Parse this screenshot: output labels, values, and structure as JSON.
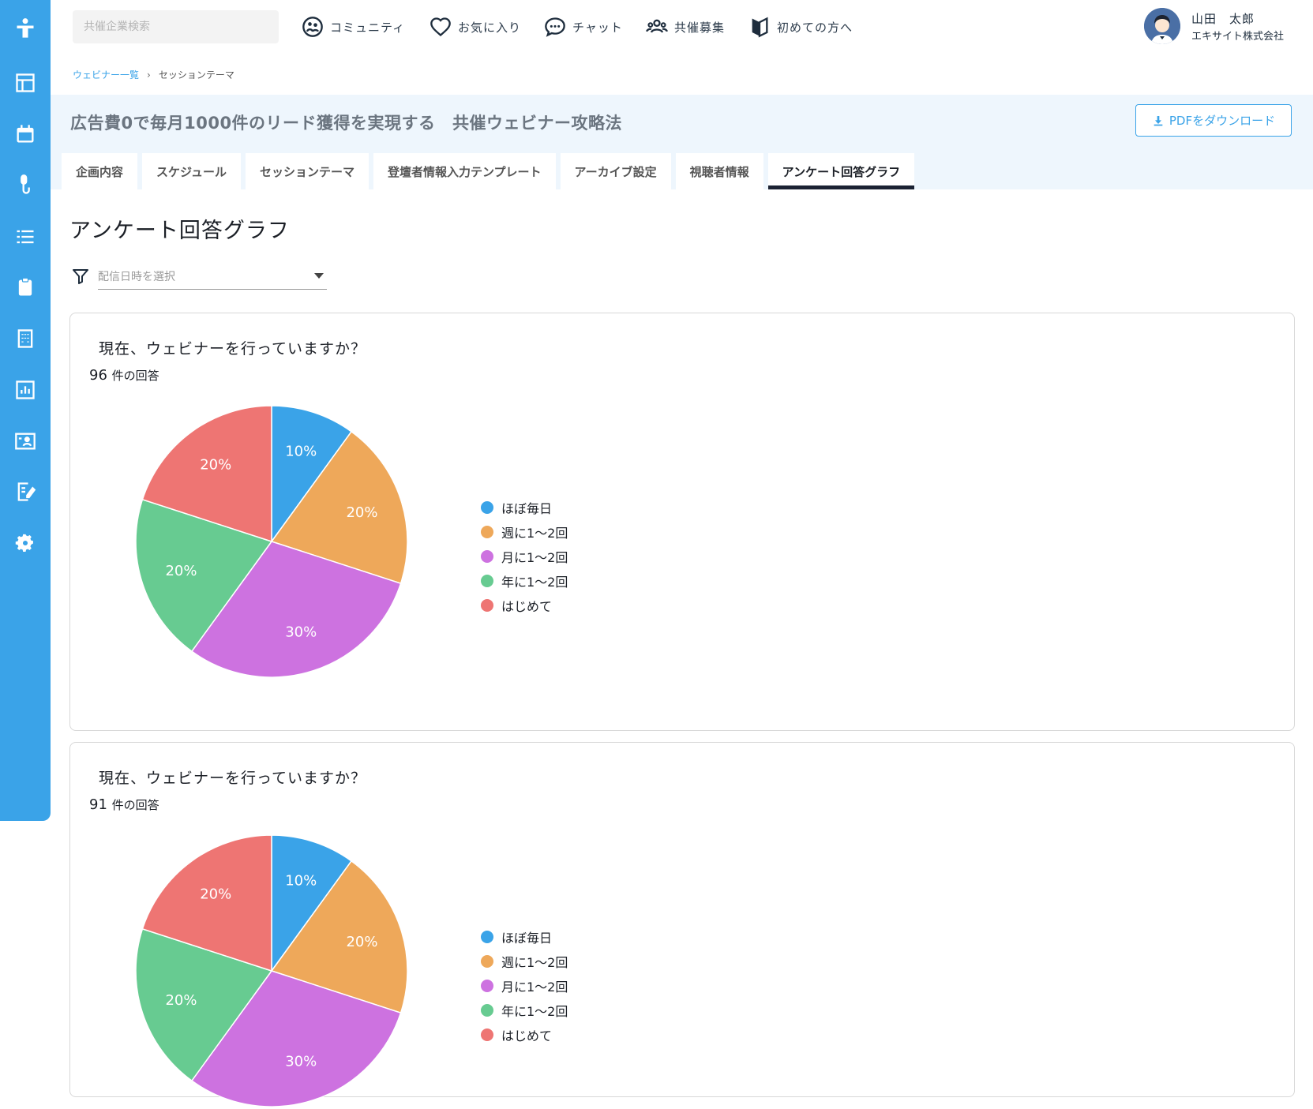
{
  "sidebar": {
    "icons": [
      "logo-person-icon",
      "dashboard-icon",
      "calendar-icon",
      "microphone-icon",
      "list-icon",
      "clipboard-icon",
      "building-icon",
      "chart-icon",
      "presentation-icon",
      "document-edit-icon",
      "gear-icon"
    ]
  },
  "header": {
    "search_placeholder": "共催企業検索",
    "nav": [
      {
        "label": "コミュニティ",
        "icon": "community-icon"
      },
      {
        "label": "お気に入り",
        "icon": "heart-icon"
      },
      {
        "label": "チャット",
        "icon": "chat-icon"
      },
      {
        "label": "共催募集",
        "icon": "group-icon"
      },
      {
        "label": "初めての方へ",
        "icon": "beginner-icon"
      }
    ],
    "user": {
      "name": "山田　太郎",
      "company": "エキサイト株式会社"
    }
  },
  "breadcrumb": {
    "parent": "ウェビナー一覧",
    "separator": "›",
    "current": "セッションテーマ"
  },
  "page": {
    "title": "広告費0で毎月1000件のリード獲得を実現する　共催ウェビナー攻略法",
    "pdf_button": "PDFをダウンロード",
    "tabs": [
      "企画内容",
      "スケジュール",
      "セッションテーマ",
      "登壇者情報入力テンプレート",
      "アーカイブ設定",
      "視聴者情報",
      "アンケート回答グラフ"
    ],
    "active_tab": "アンケート回答グラフ"
  },
  "content": {
    "heading": "アンケート回答グラフ",
    "filter_placeholder": "配信日時を選択"
  },
  "cards": [
    {
      "question": "現在、ウェビナーを行っていますか？",
      "count": "96",
      "count_unit": "件の回答"
    },
    {
      "question": "現在、ウェビナーを行っていますか？",
      "count": "91",
      "count_unit": "件の回答"
    }
  ],
  "colors": {
    "accent": "#3aa3e8",
    "s1": "#3aa3e8",
    "s2": "#eea85a",
    "s3": "#cd72e0",
    "s4": "#67cb91",
    "s5": "#ee7573"
  },
  "chart_data": [
    {
      "type": "pie",
      "categories": [
        "ほぼ毎日",
        "週に1〜2回",
        "月に1〜2回",
        "年に1〜2回",
        "はじめて"
      ],
      "values": [
        10,
        20,
        30,
        20,
        20
      ],
      "labels": [
        "10%",
        "20%",
        "30%",
        "20%",
        "20%"
      ],
      "colors": [
        "#3aa3e8",
        "#eea85a",
        "#cd72e0",
        "#67cb91",
        "#ee7573"
      ]
    },
    {
      "type": "pie",
      "categories": [
        "ほぼ毎日",
        "週に1〜2回",
        "月に1〜2回",
        "年に1〜2回",
        "はじめて"
      ],
      "values": [
        10,
        20,
        30,
        20,
        20
      ],
      "labels": [
        "10%",
        "20%",
        "30%",
        "20%",
        "20%"
      ],
      "colors": [
        "#3aa3e8",
        "#eea85a",
        "#cd72e0",
        "#67cb91",
        "#ee7573"
      ]
    }
  ]
}
